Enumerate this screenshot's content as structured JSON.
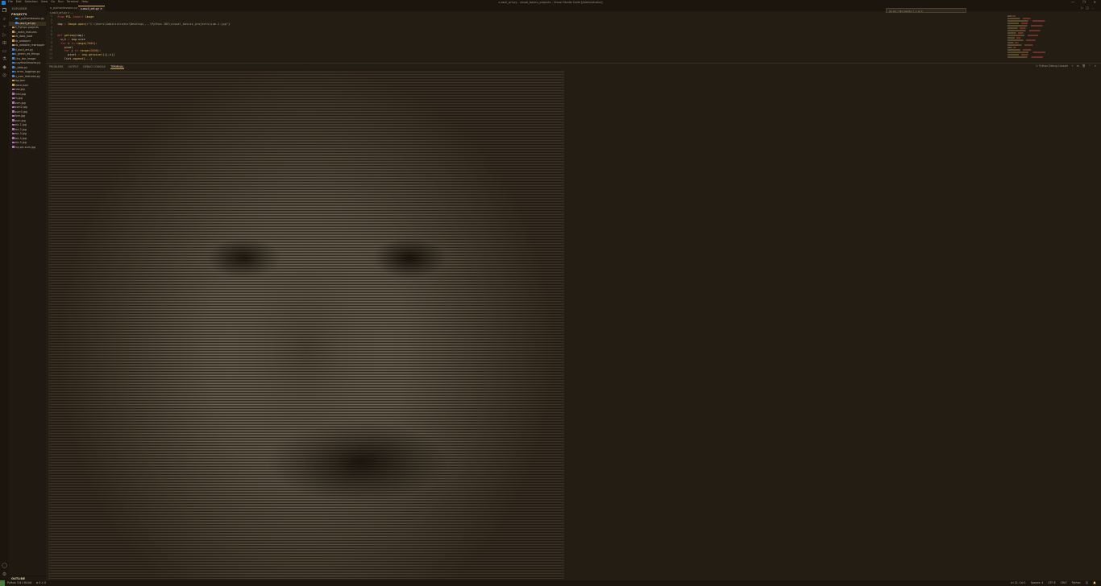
{
  "window": {
    "title": "s.ascii_art.py - visual_basics_projects - Visual Studio Code [Administrator]",
    "menu": [
      "File",
      "Edit",
      "Selection",
      "View",
      "Go",
      "Run",
      "Terminal",
      "Help"
    ],
    "controls": [
      "—",
      "❐",
      "✕"
    ]
  },
  "sidebar": {
    "header": "EXPLORER",
    "section": "PROJECTS",
    "items": [
      {
        "label": "o_pythonlessons.py",
        "kind": "py"
      },
      {
        "label": "s.ascii_art.py",
        "kind": "py",
        "selected": true
      },
      {
        "label": "3_Python projects",
        "kind": "fold"
      },
      {
        "label": "c_extra_features",
        "kind": "fold"
      },
      {
        "label": "ds_data_load",
        "kind": "fold"
      },
      {
        "label": "ds_onboard",
        "kind": "fold"
      },
      {
        "label": "ds_website_rewrapper",
        "kind": "fold"
      },
      {
        "label": "d_ascii_art.py",
        "kind": "py"
      },
      {
        "label": "k_green_ed_things",
        "kind": "py"
      },
      {
        "label": "l.ins_bar_image",
        "kind": "py"
      },
      {
        "label": "p.pythonlessons.py",
        "kind": "py"
      },
      {
        "label": "r_data.py",
        "kind": "py"
      },
      {
        "label": "s.error_loggings.py",
        "kind": "py"
      },
      {
        "label": "u_user_features.py",
        "kind": "py"
      },
      {
        "label": "log.json",
        "kind": "file"
      },
      {
        "label": "trace.json",
        "kind": "file"
      },
      {
        "label": "nao.jpg",
        "kind": "img"
      },
      {
        "label": "mini.jpg",
        "kind": "img"
      },
      {
        "label": "m.jpg",
        "kind": "img"
      },
      {
        "label": "sum.jpg",
        "kind": "img"
      },
      {
        "label": "sum2.jpg",
        "kind": "img"
      },
      {
        "label": "sum3.jpg",
        "kind": "img"
      },
      {
        "label": "fore.jpg",
        "kind": "img"
      },
      {
        "label": "sum.jpg",
        "kind": "img"
      },
      {
        "label": "aix-1.jpg",
        "kind": "img"
      },
      {
        "label": "aix-2.jpg",
        "kind": "img"
      },
      {
        "label": "aix-3.jpg",
        "kind": "img"
      },
      {
        "label": "aix-4.jpg",
        "kind": "img"
      },
      {
        "label": "aix-5.jpg",
        "kind": "img"
      },
      {
        "label": "my-pic-sum.jpg",
        "kind": "img"
      }
    ],
    "outline": "OUTLINE"
  },
  "tabs": [
    {
      "label": "o_pythonlessons.py",
      "active": false
    },
    {
      "label": "s.ascii_art.py",
      "active": true
    }
  ],
  "breadcrumb": "s.ascii_art.py > ...",
  "editor": {
    "line_numbers": [
      "1",
      "2",
      "3",
      "4",
      "5",
      "6",
      "7",
      "8",
      "9",
      "10",
      "11",
      "12"
    ],
    "lines": [
      [
        {
          "t": "from ",
          "c": "kw"
        },
        {
          "t": "PIL ",
          "c": "cls"
        },
        {
          "t": "import ",
          "c": "kw"
        },
        {
          "t": "Image",
          "c": "cls"
        }
      ],
      [],
      [
        {
          "t": "img ",
          "c": ""
        },
        {
          "t": "= ",
          "c": "kw"
        },
        {
          "t": "Image",
          "c": "cls"
        },
        {
          "t": ".open(",
          "c": "fn"
        },
        {
          "t": "r\"C:\\Users\\Administrator\\Desktop\\...\\Python IDE\\visual_basics_projects\\sum-1.jpg\"",
          "c": "str"
        },
        {
          "t": ")",
          "c": ""
        }
      ],
      [],
      [],
      [
        {
          "t": "def ",
          "c": "kw"
        },
        {
          "t": "getimg",
          "c": "fn"
        },
        {
          "t": "(img):",
          "c": ""
        }
      ],
      [
        {
          "t": "  w,h ",
          "c": ""
        },
        {
          "t": "= ",
          "c": "kw"
        },
        {
          "t": "img.size",
          "c": ""
        }
      ],
      [
        {
          "t": "  for ",
          "c": "kw"
        },
        {
          "t": "i ",
          "c": ""
        },
        {
          "t": "in ",
          "c": "kw"
        },
        {
          "t": "range",
          "c": "fn"
        },
        {
          "t": "(",
          "c": ""
        },
        {
          "t": "2000",
          "c": "num"
        },
        {
          "t": "):",
          "c": ""
        }
      ],
      [
        {
          "t": "    pixel",
          "c": ""
        }
      ],
      [
        {
          "t": "    for ",
          "c": "kw"
        },
        {
          "t": "j ",
          "c": ""
        },
        {
          "t": "in ",
          "c": "kw"
        },
        {
          "t": "range",
          "c": "fn"
        },
        {
          "t": "(",
          "c": ""
        },
        {
          "t": "2000",
          "c": "num"
        },
        {
          "t": "):",
          "c": ""
        }
      ],
      [
        {
          "t": "      pixel ",
          "c": ""
        },
        {
          "t": "= ",
          "c": "kw"
        },
        {
          "t": "img.getpixel",
          "c": "fn"
        },
        {
          "t": "((j,i))",
          "c": ""
        }
      ],
      [
        {
          "t": "    list",
          "c": ""
        },
        {
          "t": ".append",
          "c": "fn"
        },
        {
          "t": "(...)",
          "c": ""
        }
      ]
    ]
  },
  "panel": {
    "tabs": [
      {
        "label": "PROBLEMS",
        "active": false
      },
      {
        "label": "OUTPUT",
        "active": false
      },
      {
        "label": "DEBUG CONSOLE",
        "active": false
      },
      {
        "label": "TERMINAL",
        "active": true
      }
    ],
    "terminal_select": "1: Python Debug Console",
    "tools": [
      "+",
      "⊟",
      "🗑",
      "^",
      "✕"
    ]
  },
  "statusbar": {
    "left": [
      "Python 3.8.2 64-bit",
      "⊗ 0 ⚠ 0"
    ],
    "right": [
      "Ln 11, Col 1",
      "Spaces: 4",
      "UTF-8",
      "CRLF",
      "Python",
      "☺",
      "🔔"
    ]
  },
  "colors": {
    "background": "#241d14",
    "accent": "#d8a64a",
    "keyword": "#e0444a",
    "function": "#e9b84c"
  }
}
